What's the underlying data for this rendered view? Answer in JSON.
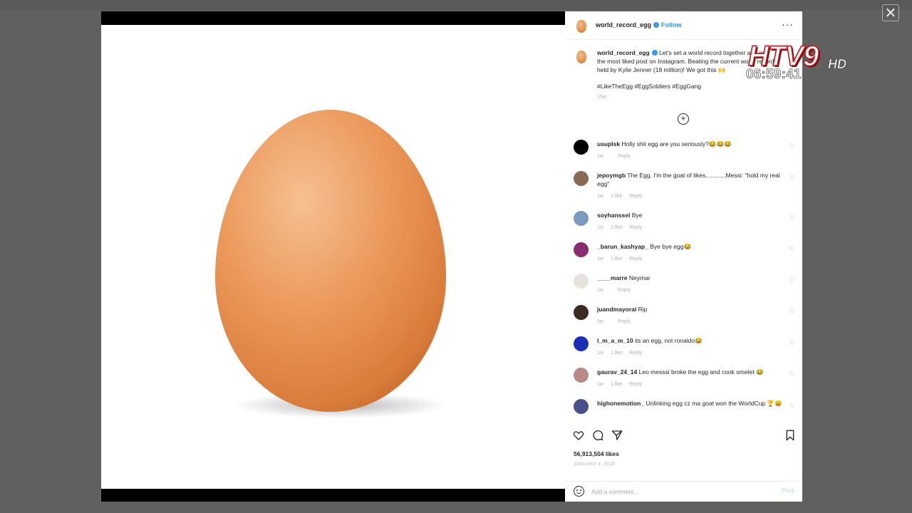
{
  "viewer": {
    "close_label": "×"
  },
  "post": {
    "username": "world_record_egg",
    "follow_label": "Follow",
    "dot": "•",
    "more_label": "···",
    "caption_user": "world_record_egg",
    "caption_text": "Let's set a world record together and get the most liked post on Instagram. Beating the current world record held by Kylie Jenner (18 million)! We got this 🙌",
    "hashtags": "#LikeTheEgg #EggSoldiers #EggGang",
    "caption_time": "16w",
    "load_more_label": "+",
    "likes_text": "56,913,504 likes",
    "date_text": "JANUARY 4, 2019"
  },
  "comments": [
    {
      "user": "usuplsk",
      "text": "Holly shit egg are you seriously?😂😂😂",
      "time": "1w",
      "likes": "",
      "reply": "Reply",
      "avatar_color": "#000000"
    },
    {
      "user": "jepoymgb",
      "text": "The Egg. I'm the goat of likes............Messi: \"hold my real egg\"",
      "time": "1w",
      "likes": "1 like",
      "reply": "Reply",
      "avatar_color": "#8a6a55"
    },
    {
      "user": "soyhanssel",
      "text": "Bye",
      "time": "1w",
      "likes": "1 like",
      "reply": "Reply",
      "avatar_color": "#7b9bbd"
    },
    {
      "user": "_barun_kashyap_",
      "text": "Bye bye egg😂",
      "time": "1w",
      "likes": "1 like",
      "reply": "Reply",
      "avatar_color": "#8a2d6e"
    },
    {
      "user": "____marre",
      "text": "Neymar",
      "time": "1w",
      "likes": "",
      "reply": "Reply",
      "avatar_color": "#e8e2dc"
    },
    {
      "user": "juandmayoral",
      "text": "Rip",
      "time": "1w",
      "likes": "",
      "reply": "Reply",
      "avatar_color": "#3a2a22"
    },
    {
      "user": "l_m_a_m_10",
      "text": "its an egg, not ronaldo😂",
      "time": "1w",
      "likes": "1 like",
      "reply": "Reply",
      "avatar_color": "#1a2fb5"
    },
    {
      "user": "gaurav_24_14",
      "text": "Leo messsi broke the egg and cook omelet 😂",
      "time": "1w",
      "likes": "1 like",
      "reply": "Reply",
      "avatar_color": "#b88a86"
    },
    {
      "user": "highonemotion_",
      "text": "Unlinking egg cz ma goat won the WorldCup 🏆😄",
      "time": "",
      "likes": "",
      "reply": "",
      "avatar_color": "#4a4f8a"
    }
  ],
  "add_comment": {
    "placeholder": "Add a comment...",
    "post_label": "Post"
  },
  "overlay": {
    "brand": "HTV9",
    "hd": "HD",
    "clock": "06:59:41"
  },
  "colors": {
    "accent": "#3897f0",
    "egg": "#e8975a",
    "backdrop": "#606060"
  }
}
